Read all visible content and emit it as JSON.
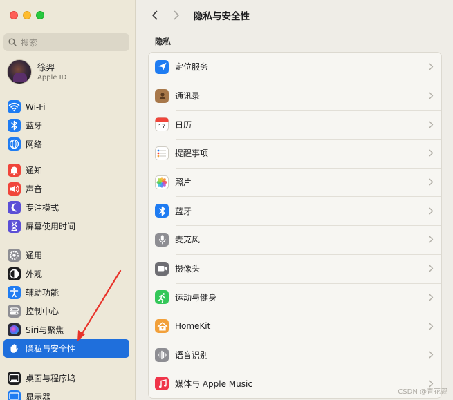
{
  "sidebar": {
    "search_placeholder": "搜索",
    "account": {
      "name": "徐羿",
      "subtitle": "Apple ID"
    },
    "groups": [
      [
        {
          "label": "Wi-Fi",
          "icon": "wifi-icon",
          "color": "#1f7cf2"
        },
        {
          "label": "蓝牙",
          "icon": "bluetooth-icon",
          "color": "#1f7cf2"
        },
        {
          "label": "网络",
          "icon": "globe-icon",
          "color": "#1f7cf2"
        }
      ],
      [
        {
          "label": "通知",
          "icon": "bell-icon",
          "color": "#f0453a"
        },
        {
          "label": "声音",
          "icon": "speaker-icon",
          "color": "#f0453a"
        },
        {
          "label": "专注模式",
          "icon": "moon-icon",
          "color": "#5b4fd6"
        },
        {
          "label": "屏幕使用时间",
          "icon": "hourglass-icon",
          "color": "#5b4fd6"
        }
      ],
      [
        {
          "label": "通用",
          "icon": "gear-icon",
          "color": "#8e8e93"
        },
        {
          "label": "外观",
          "icon": "appearance-icon",
          "color": "#1d1d1f"
        },
        {
          "label": "辅助功能",
          "icon": "accessibility-icon",
          "color": "#1f7cf2"
        },
        {
          "label": "控制中心",
          "icon": "control-center-icon",
          "color": "#8e8e93"
        },
        {
          "label": "Siri与聚焦",
          "icon": "siri-icon",
          "color": "#2b2b3a"
        },
        {
          "label": "隐私与安全性",
          "icon": "hand-icon",
          "color": "#1f7cf2",
          "active": true
        }
      ],
      [
        {
          "label": "桌面与程序坞",
          "icon": "dock-icon",
          "color": "#1d1d1f"
        },
        {
          "label": "显示器",
          "icon": "display-icon",
          "color": "#1f7cf2"
        }
      ]
    ]
  },
  "toolbar": {
    "title": "隐私与安全性"
  },
  "main": {
    "section_title": "隐私",
    "rows": [
      {
        "label": "定位服务",
        "icon": "location-arrow-icon",
        "color": "#1f7cf2"
      },
      {
        "label": "通讯录",
        "icon": "contacts-icon",
        "color": "#a8784a"
      },
      {
        "label": "日历",
        "icon": "calendar-icon",
        "color": "#ffffff",
        "day": "17"
      },
      {
        "label": "提醒事项",
        "icon": "reminders-icon",
        "color": "#ffffff"
      },
      {
        "label": "照片",
        "icon": "photos-icon",
        "color": "#ffffff"
      },
      {
        "label": "蓝牙",
        "icon": "bluetooth-icon",
        "color": "#1f7cf2"
      },
      {
        "label": "麦克风",
        "icon": "microphone-icon",
        "color": "#8e8e93"
      },
      {
        "label": "摄像头",
        "icon": "camera-icon",
        "color": "#6e6e73"
      },
      {
        "label": "运动与健身",
        "icon": "fitness-icon",
        "color": "#34c759"
      },
      {
        "label": "HomeKit",
        "icon": "home-icon",
        "color": "#f2a03a"
      },
      {
        "label": "语音识别",
        "icon": "waveform-icon",
        "color": "#8e8e93"
      },
      {
        "label": "媒体与 Apple Music",
        "icon": "music-icon",
        "color": "#f0354a"
      }
    ]
  },
  "watermark": "CSDN @青花瓷",
  "annotation_color": "#e8332a"
}
